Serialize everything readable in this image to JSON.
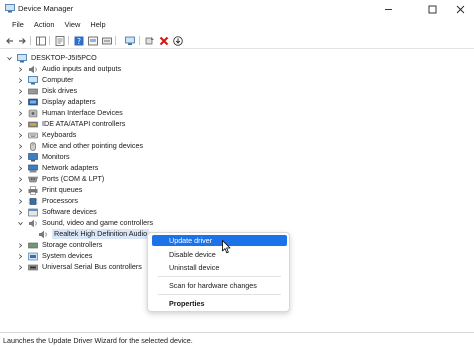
{
  "window": {
    "title": "Device Manager"
  },
  "menu": [
    "File",
    "Action",
    "View",
    "Help"
  ],
  "tree": {
    "root": "DESKTOP-J5I5PCO",
    "categories": [
      "Audio inputs and outputs",
      "Computer",
      "Disk drives",
      "Display adapters",
      "Human Interface Devices",
      "IDE ATA/ATAPI controllers",
      "Keyboards",
      "Mice and other pointing devices",
      "Monitors",
      "Network adapters",
      "Ports (COM & LPT)",
      "Print queues",
      "Processors",
      "Software devices",
      "Sound, video and game controllers",
      "Storage controllers",
      "System devices",
      "Universal Serial Bus controllers"
    ],
    "selected_device": "Realtek High Definition Audio"
  },
  "context_menu": {
    "items": [
      "Update driver",
      "Disable device",
      "Uninstall device",
      "Scan for hardware changes",
      "Properties"
    ]
  },
  "status": {
    "text": "Launches the Update Driver Wizard for the selected device."
  }
}
